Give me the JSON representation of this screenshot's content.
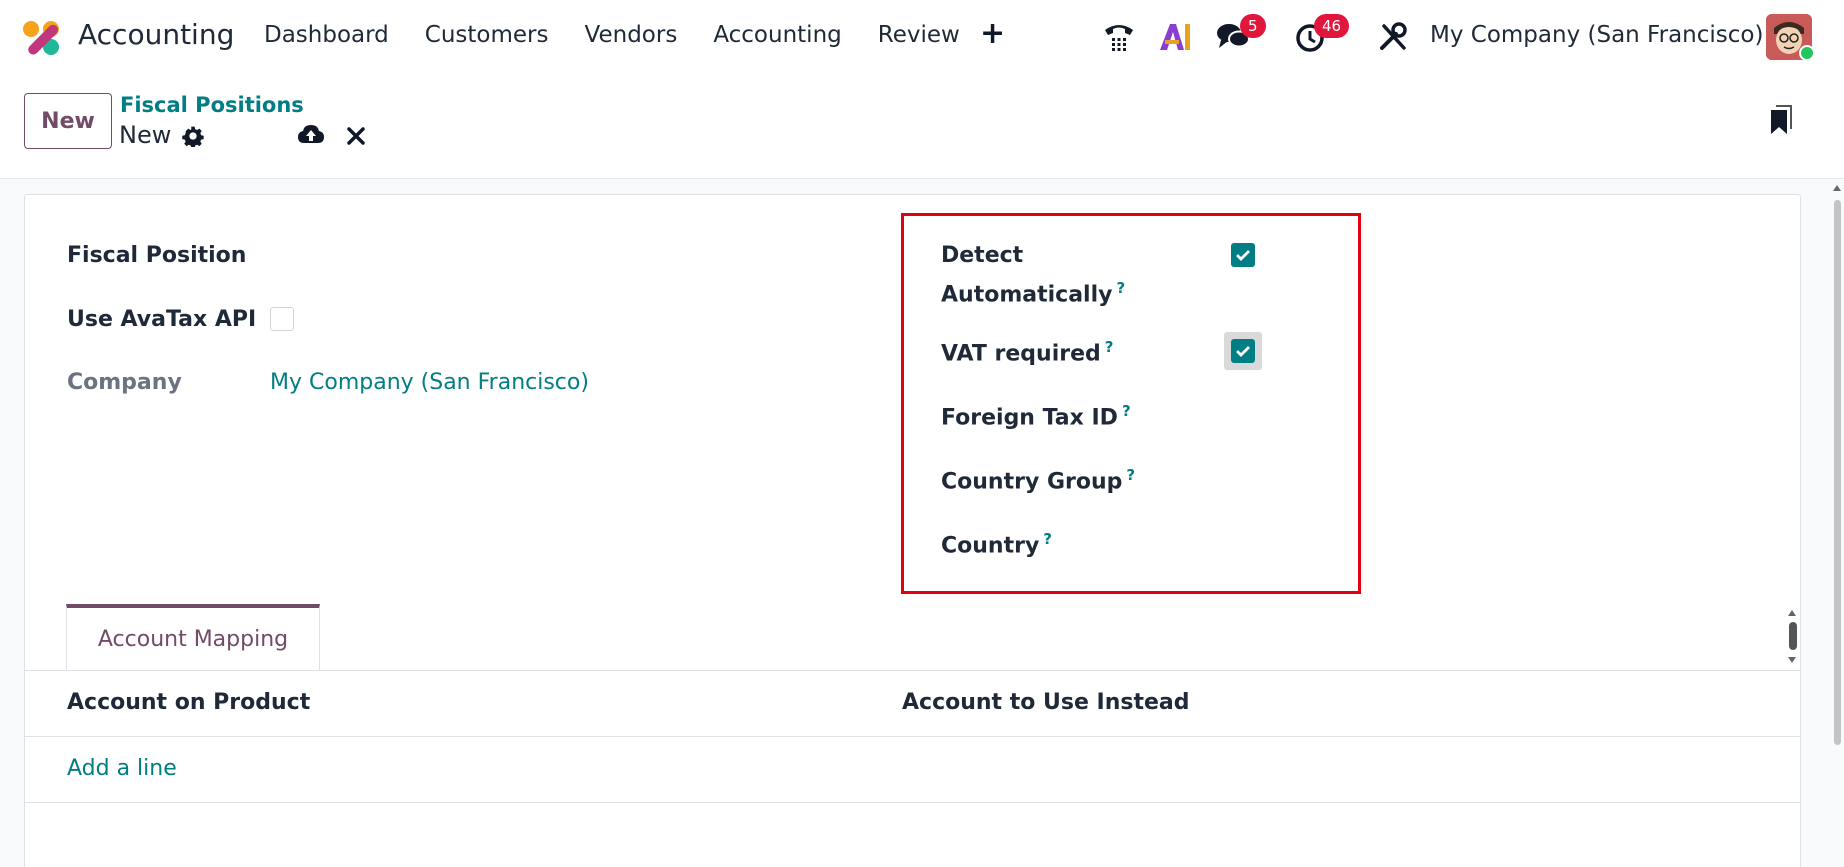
{
  "navbar": {
    "app_title": "Accounting",
    "menu": [
      "Dashboard",
      "Customers",
      "Vendors",
      "Accounting",
      "Review"
    ],
    "add_symbol": "+",
    "icons": [
      "phone-icon",
      "ai-icon",
      "chat-icon",
      "activity-clock-icon",
      "tools-icon"
    ],
    "chat_badge": "5",
    "activity_badge": "46",
    "company": "My Company (San Francisco)",
    "brand_colors": {
      "teal": "#017e84",
      "purple": "#714b67",
      "badge": "#e1163c"
    }
  },
  "control": {
    "new_button": "New",
    "breadcrumb": "Fiscal Positions",
    "record_name": "New"
  },
  "form": {
    "fiscal_position_label": "Fiscal Position",
    "use_avatax_label": "Use AvaTax API",
    "use_avatax_checked": false,
    "company_label": "Company",
    "company_value": "My Company (San Francisco)",
    "detect_line1": "Detect",
    "detect_line2": "Automatically",
    "detect_checked": true,
    "vat_required_label": "VAT required",
    "vat_required_checked": true,
    "foreign_tax_label": "Foreign Tax ID",
    "country_group_label": "Country Group",
    "country_label": "Country",
    "help_mark": "?"
  },
  "tabs": [
    {
      "label": "Account Mapping",
      "active": true
    }
  ],
  "table": {
    "headers": [
      "Account on Product",
      "Account to Use Instead"
    ],
    "add_line": "Add a line"
  }
}
